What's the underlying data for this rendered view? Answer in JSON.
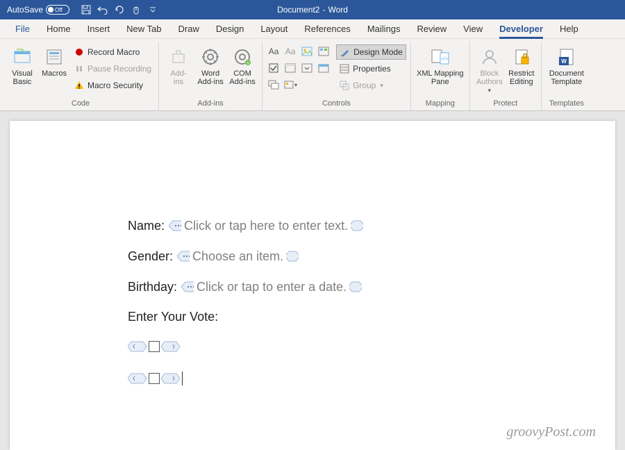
{
  "title": {
    "autosave": "AutoSave",
    "toggle": "Off",
    "doc": "Document2",
    "app": "Word"
  },
  "tabs": [
    "File",
    "Home",
    "Insert",
    "New Tab",
    "Draw",
    "Design",
    "Layout",
    "References",
    "Mailings",
    "Review",
    "View",
    "Developer",
    "Help"
  ],
  "active_tab": "Developer",
  "ribbon": {
    "code": {
      "label": "Code",
      "visual_basic": "Visual\nBasic",
      "macros": "Macros",
      "record": "Record Macro",
      "pause": "Pause Recording",
      "security": "Macro Security"
    },
    "addins": {
      "label": "Add-ins",
      "addins": "Add-\nins",
      "word": "Word\nAdd-ins",
      "com": "COM\nAdd-ins"
    },
    "controls": {
      "label": "Controls",
      "design_mode": "Design Mode",
      "properties": "Properties",
      "group": "Group"
    },
    "mapping": {
      "label": "Mapping",
      "xml": "XML Mapping\nPane"
    },
    "protect": {
      "label": "Protect",
      "block": "Block\nAuthors",
      "restrict": "Restrict\nEditing"
    },
    "templates": {
      "label": "Templates",
      "template": "Document\nTemplate"
    }
  },
  "form": {
    "name_label": "Name:",
    "name_placeholder": "Click or tap here to enter text.",
    "gender_label": "Gender:",
    "gender_placeholder": "Choose an item.",
    "birthday_label": "Birthday:",
    "birthday_placeholder": "Click or tap to enter a date.",
    "vote_label": "Enter Your Vote:"
  },
  "watermark": "groovyPost.com"
}
